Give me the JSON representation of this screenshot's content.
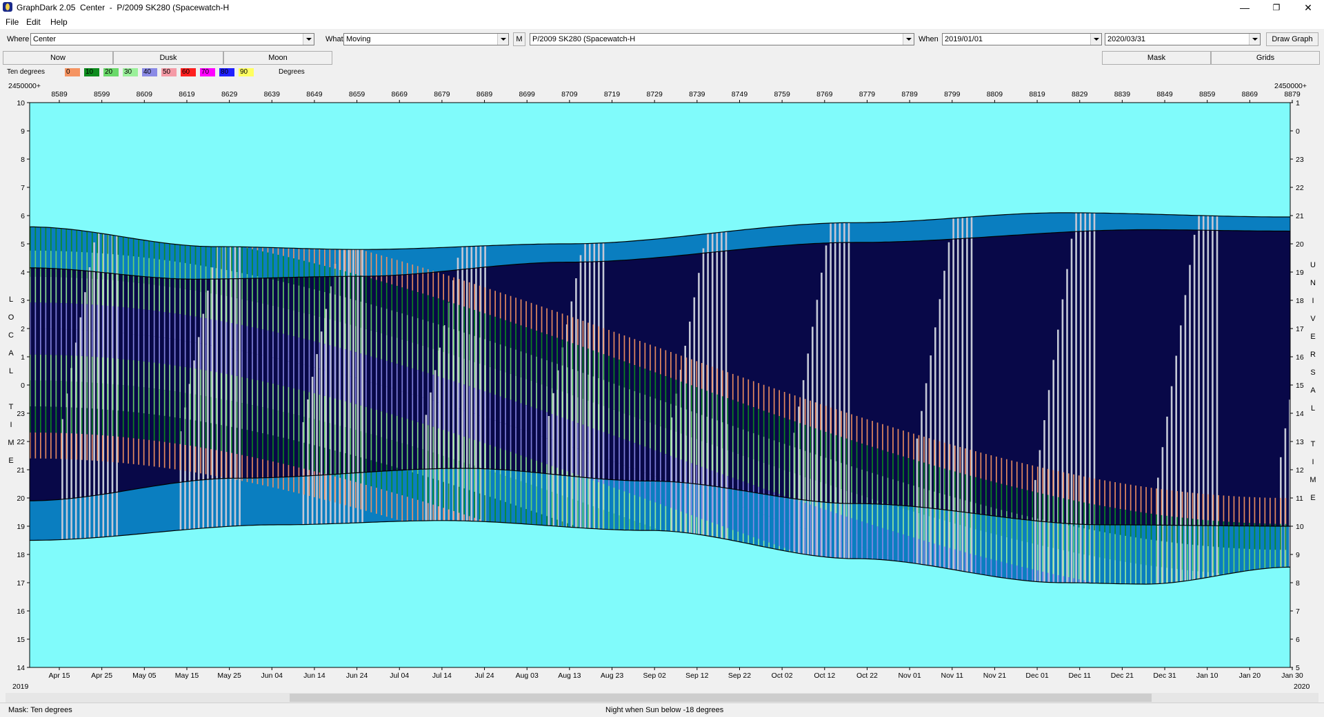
{
  "window": {
    "title": "GraphDark 2.05  Center  -  P/2009 SK280 (Spacewatch-H",
    "minimize": "—",
    "maximize": "❐",
    "close": "✕"
  },
  "menu": [
    "File",
    "Edit",
    "Help"
  ],
  "toolbar": {
    "where_label": "Where",
    "where_value": "Center",
    "what_label": "What",
    "what_value": "Moving",
    "m_button": "M",
    "object_value": "P/2009 SK280 (Spacewatch-H",
    "when_label": "When",
    "start_date": "2019/01/01",
    "end_date": "2020/03/31",
    "draw_button": "Draw Graph"
  },
  "tabs": {
    "now": "Now",
    "dusk": "Dusk",
    "moon": "Moon",
    "mask": "Mask",
    "grids": "Grids"
  },
  "legend": {
    "title": "Ten degrees",
    "unit": "Degrees",
    "entries": [
      {
        "label": "0",
        "color": "#f59462"
      },
      {
        "label": "10",
        "color": "#0e8c1e"
      },
      {
        "label": "20",
        "color": "#6ad96a"
      },
      {
        "label": "30",
        "color": "#9af09a"
      },
      {
        "label": "40",
        "color": "#8a8ae6"
      },
      {
        "label": "50",
        "color": "#f59aa6"
      },
      {
        "label": "60",
        "color": "#ff2020"
      },
      {
        "label": "70",
        "color": "#ff00ff"
      },
      {
        "label": "80",
        "color": "#2020ff"
      },
      {
        "label": "90",
        "color": "#ffff60"
      }
    ]
  },
  "chart_data": {
    "type": "heatmap",
    "jd_prefix": "2450000+",
    "top_axis_ticks": [
      "8589",
      "8599",
      "8609",
      "8619",
      "8629",
      "8639",
      "8649",
      "8659",
      "8669",
      "8679",
      "8689",
      "8699",
      "8709",
      "8719",
      "8729",
      "8739",
      "8749",
      "8759",
      "8769",
      "8779",
      "8789",
      "8799",
      "8809",
      "8819",
      "8829",
      "8839",
      "8849",
      "8859",
      "8869",
      "8879"
    ],
    "bottom_axis_ticks": [
      "Apr 15",
      "Apr 25",
      "May 05",
      "May 15",
      "May 25",
      "Jun 04",
      "Jun 14",
      "Jun 24",
      "Jul 04",
      "Jul 14",
      "Jul 24",
      "Aug 03",
      "Aug 13",
      "Aug 23",
      "Sep 02",
      "Sep 12",
      "Sep 22",
      "Oct 02",
      "Oct 12",
      "Oct 22",
      "Nov 01",
      "Nov 11",
      "Nov 21",
      "Dec 01",
      "Dec 11",
      "Dec 21",
      "Dec 31",
      "Jan 10",
      "Jan 20",
      "Jan 30"
    ],
    "start_year": "2019",
    "end_year": "2020",
    "left_axis_ticks": [
      "10",
      "9",
      "8",
      "7",
      "6",
      "5",
      "4",
      "3",
      "2",
      "1",
      "0",
      "23",
      "22",
      "21",
      "20",
      "19",
      "18",
      "17",
      "16",
      "15",
      "14"
    ],
    "right_axis_ticks": [
      "1",
      "0",
      "23",
      "22",
      "21",
      "20",
      "19",
      "18",
      "17",
      "16",
      "15",
      "14",
      "13",
      "12",
      "11",
      "10",
      "9",
      "8",
      "7",
      "6",
      "5"
    ],
    "left_axis_label": "LOCAL TIME",
    "right_axis_label": "UNIVERSAL TIME",
    "x_range_days": [
      0,
      305
    ],
    "y_range_hours": [
      14,
      34
    ],
    "dusk_curve": [
      [
        0,
        19.9
      ],
      [
        50,
        20.7
      ],
      [
        105,
        21.05
      ],
      [
        150,
        20.6
      ],
      [
        200,
        19.8
      ],
      [
        260,
        19.05
      ],
      [
        305,
        19.0
      ]
    ],
    "dawn_curve": [
      [
        0,
        28.15
      ],
      [
        40,
        27.75
      ],
      [
        80,
        27.85
      ],
      [
        130,
        28.35
      ],
      [
        200,
        29.05
      ],
      [
        270,
        29.5
      ],
      [
        305,
        29.45
      ]
    ],
    "astro_dusk_curve": [
      [
        0,
        18.5
      ],
      [
        60,
        19.05
      ],
      [
        100,
        19.2
      ],
      [
        150,
        18.85
      ],
      [
        200,
        17.85
      ],
      [
        250,
        17.0
      ],
      [
        270,
        16.95
      ],
      [
        305,
        17.55
      ]
    ],
    "astro_dawn_curve": [
      [
        0,
        29.6
      ],
      [
        45,
        28.9
      ],
      [
        80,
        28.8
      ],
      [
        130,
        29.0
      ],
      [
        200,
        29.75
      ],
      [
        250,
        30.1
      ],
      [
        305,
        29.95
      ]
    ],
    "object_transit_curve": [
      [
        0,
        30.6
      ],
      [
        305,
        20.0
      ]
    ],
    "colors": {
      "day": "#80fbfb",
      "twilight": "#0a7ec0",
      "night": "#080848",
      "moonlit": "#c4c8d6"
    }
  },
  "status": {
    "left": "Mask:  Ten degrees",
    "center": "Night when Sun below -18 degrees"
  }
}
